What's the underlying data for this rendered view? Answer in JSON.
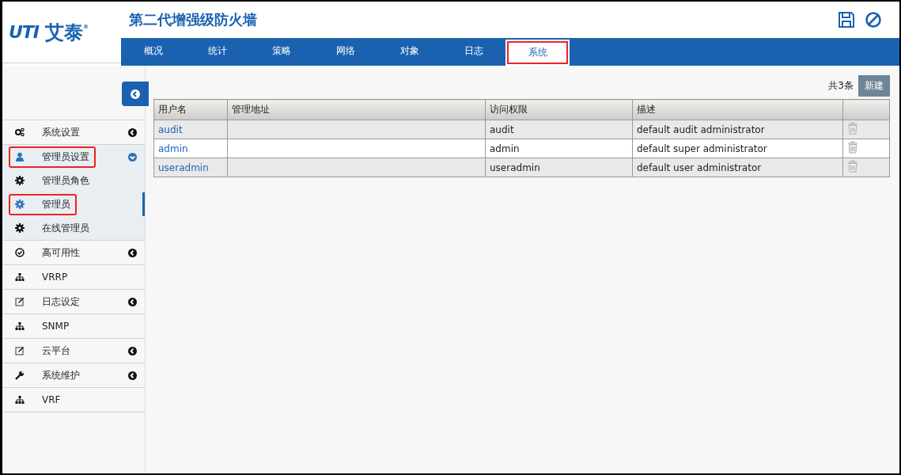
{
  "logo": {
    "mark": "UTI",
    "name": "艾泰",
    "registered": "®"
  },
  "header": {
    "title": "第二代增强级防火墙"
  },
  "nav_tabs": [
    {
      "label": "概况",
      "selected": false,
      "highlighted": false
    },
    {
      "label": "统计",
      "selected": false,
      "highlighted": false
    },
    {
      "label": "策略",
      "selected": false,
      "highlighted": false
    },
    {
      "label": "网络",
      "selected": false,
      "highlighted": false
    },
    {
      "label": "对象",
      "selected": false,
      "highlighted": false
    },
    {
      "label": "日志",
      "selected": false,
      "highlighted": false
    },
    {
      "label": "系统",
      "selected": true,
      "highlighted": true
    }
  ],
  "sidebar": {
    "items": [
      {
        "label": "系统设置",
        "kind": "gears",
        "expandable": true,
        "expanded": false,
        "highlighted": false
      },
      {
        "label": "管理员设置",
        "kind": "user",
        "expandable": true,
        "expanded": true,
        "highlighted": true,
        "children": [
          {
            "label": "管理员角色",
            "kind": "gear",
            "selected": false,
            "highlighted": false
          },
          {
            "label": "管理员",
            "kind": "gear",
            "selected": true,
            "highlighted": true
          },
          {
            "label": "在线管理员",
            "kind": "gear",
            "selected": false,
            "highlighted": false
          }
        ]
      },
      {
        "label": "高可用性",
        "kind": "check",
        "expandable": true,
        "expanded": false,
        "highlighted": false
      },
      {
        "label": "VRRP",
        "kind": "sitemap",
        "expandable": false,
        "expanded": false,
        "highlighted": false
      },
      {
        "label": "日志设定",
        "kind": "edit",
        "expandable": true,
        "expanded": false,
        "highlighted": false
      },
      {
        "label": "SNMP",
        "kind": "sitemap",
        "expandable": false,
        "expanded": false,
        "highlighted": false
      },
      {
        "label": "云平台",
        "kind": "edit",
        "expandable": true,
        "expanded": false,
        "highlighted": false
      },
      {
        "label": "系统维护",
        "kind": "wrench",
        "expandable": true,
        "expanded": false,
        "highlighted": false
      },
      {
        "label": "VRF",
        "kind": "sitemap",
        "expandable": false,
        "expanded": false,
        "highlighted": false
      }
    ]
  },
  "toolbar": {
    "count": "共3条",
    "new_button": "新建"
  },
  "table": {
    "columns": [
      "用户名",
      "管理地址",
      "访问权限",
      "描述"
    ],
    "rows": [
      {
        "username": "audit",
        "address": "",
        "access": "audit",
        "description": "default audit administrator"
      },
      {
        "username": "admin",
        "address": "",
        "access": "admin",
        "description": "default super administrator"
      },
      {
        "username": "useradmin",
        "address": "",
        "access": "useradmin",
        "description": "default user administrator"
      }
    ]
  }
}
